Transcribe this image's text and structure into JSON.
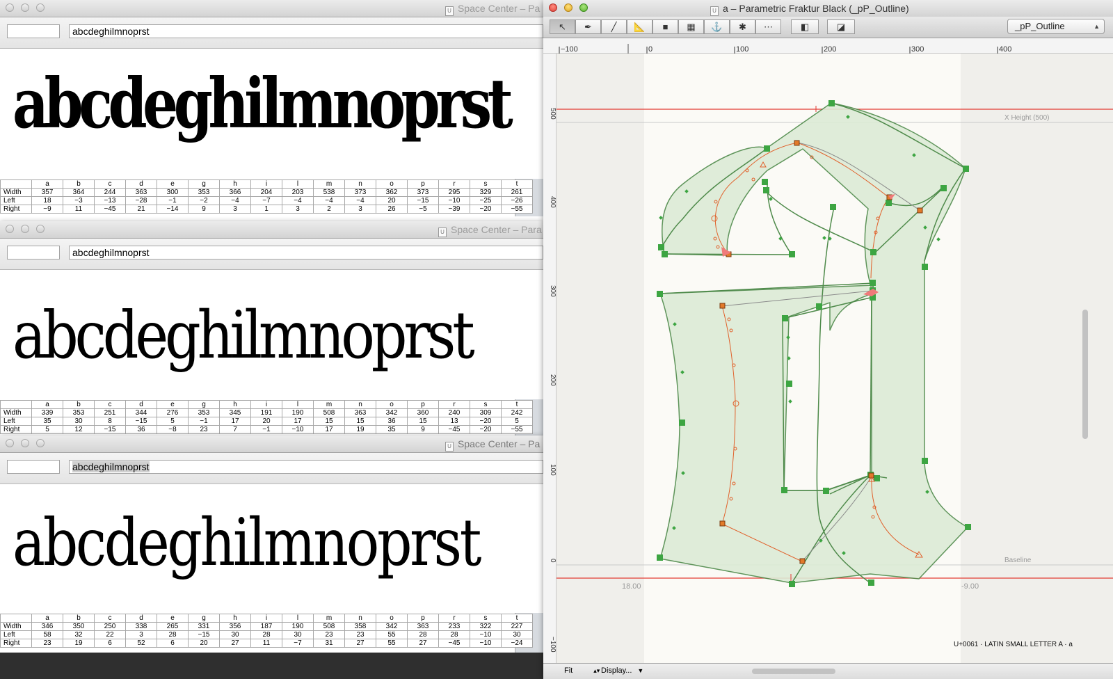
{
  "space_centers": [
    {
      "title": "Space Center – Pa",
      "input_text": "abcdeghilmnoprst",
      "preview_text": "abcdeghilmnoprst",
      "glyph_names": [
        "a",
        "b",
        "c",
        "d",
        "e",
        "g",
        "h",
        "i",
        "l",
        "m",
        "n",
        "o",
        "p",
        "r",
        "s",
        "t"
      ],
      "width": [
        "357",
        "364",
        "244",
        "363",
        "300",
        "353",
        "366",
        "204",
        "203",
        "538",
        "373",
        "362",
        "373",
        "295",
        "329",
        "261"
      ],
      "left": [
        "18",
        "−3",
        "−13",
        "−28",
        "−1",
        "−2",
        "−4",
        "−7",
        "−4",
        "−4",
        "−4",
        "20",
        "−15",
        "−10",
        "−25",
        "−26"
      ],
      "right": [
        "−9",
        "11",
        "−45",
        "21",
        "−14",
        "9",
        "3",
        "1",
        "3",
        "2",
        "3",
        "26",
        "−5",
        "−39",
        "−20",
        "−55"
      ]
    },
    {
      "title": "Space Center – Para",
      "input_text": "abcdeghilmnoprst",
      "preview_text": "abcdeghilmnoprst",
      "glyph_names": [
        "a",
        "b",
        "c",
        "d",
        "e",
        "g",
        "h",
        "i",
        "l",
        "m",
        "n",
        "o",
        "p",
        "r",
        "s",
        "t"
      ],
      "width": [
        "339",
        "353",
        "251",
        "344",
        "276",
        "353",
        "345",
        "191",
        "190",
        "508",
        "363",
        "342",
        "360",
        "240",
        "309",
        "242"
      ],
      "left": [
        "35",
        "30",
        "8",
        "−15",
        "5",
        "−1",
        "17",
        "20",
        "17",
        "15",
        "15",
        "36",
        "15",
        "13",
        "−20",
        "5"
      ],
      "right": [
        "5",
        "12",
        "−15",
        "36",
        "−8",
        "23",
        "7",
        "−1",
        "−10",
        "17",
        "19",
        "35",
        "9",
        "−45",
        "−20",
        "−55"
      ]
    },
    {
      "title": "Space Center – Pa",
      "input_text": "abcdeghilmnoprst",
      "preview_text": "abcdeghilmnoprst",
      "glyph_names": [
        "a",
        "b",
        "c",
        "d",
        "e",
        "g",
        "h",
        "i",
        "l",
        "m",
        "n",
        "o",
        "p",
        "r",
        "s",
        "t"
      ],
      "width": [
        "346",
        "350",
        "250",
        "338",
        "265",
        "331",
        "356",
        "187",
        "190",
        "508",
        "358",
        "342",
        "363",
        "233",
        "322",
        "227"
      ],
      "left": [
        "58",
        "32",
        "22",
        "3",
        "28",
        "−15",
        "30",
        "28",
        "30",
        "23",
        "23",
        "55",
        "28",
        "28",
        "−10",
        "30"
      ],
      "right": [
        "23",
        "19",
        "6",
        "52",
        "6",
        "20",
        "27",
        "11",
        "−7",
        "31",
        "27",
        "55",
        "27",
        "−45",
        "−10",
        "−24"
      ]
    }
  ],
  "row_labels": {
    "width": "Width",
    "left": "Left",
    "right": "Right"
  },
  "glyph_window": {
    "title": "a – Parametric Fraktur Black (_pP_Outline)",
    "layer": "_pP_Outline",
    "ruler_labels": [
      "−100",
      "0",
      "100",
      "200",
      "300",
      "400"
    ],
    "vertical_ruler_labels": [
      "500",
      "400",
      "300",
      "200",
      "100",
      "0",
      "−100"
    ],
    "x_height_label": "X Height (500)",
    "baseline_label": "Baseline",
    "left_margin": "18.00",
    "right_margin": "-9.00",
    "glyph_info": "U+0061 · LATIN SMALL LETTER A · a",
    "zoom": "Fit",
    "display_menu": "Display..."
  },
  "colors": {
    "outline_fill": "#dcebd6",
    "outline_stroke": "#4e8a4a",
    "oncurve_point": "#3da542",
    "skeleton": "#e0602a",
    "guide": "#e23a32"
  }
}
